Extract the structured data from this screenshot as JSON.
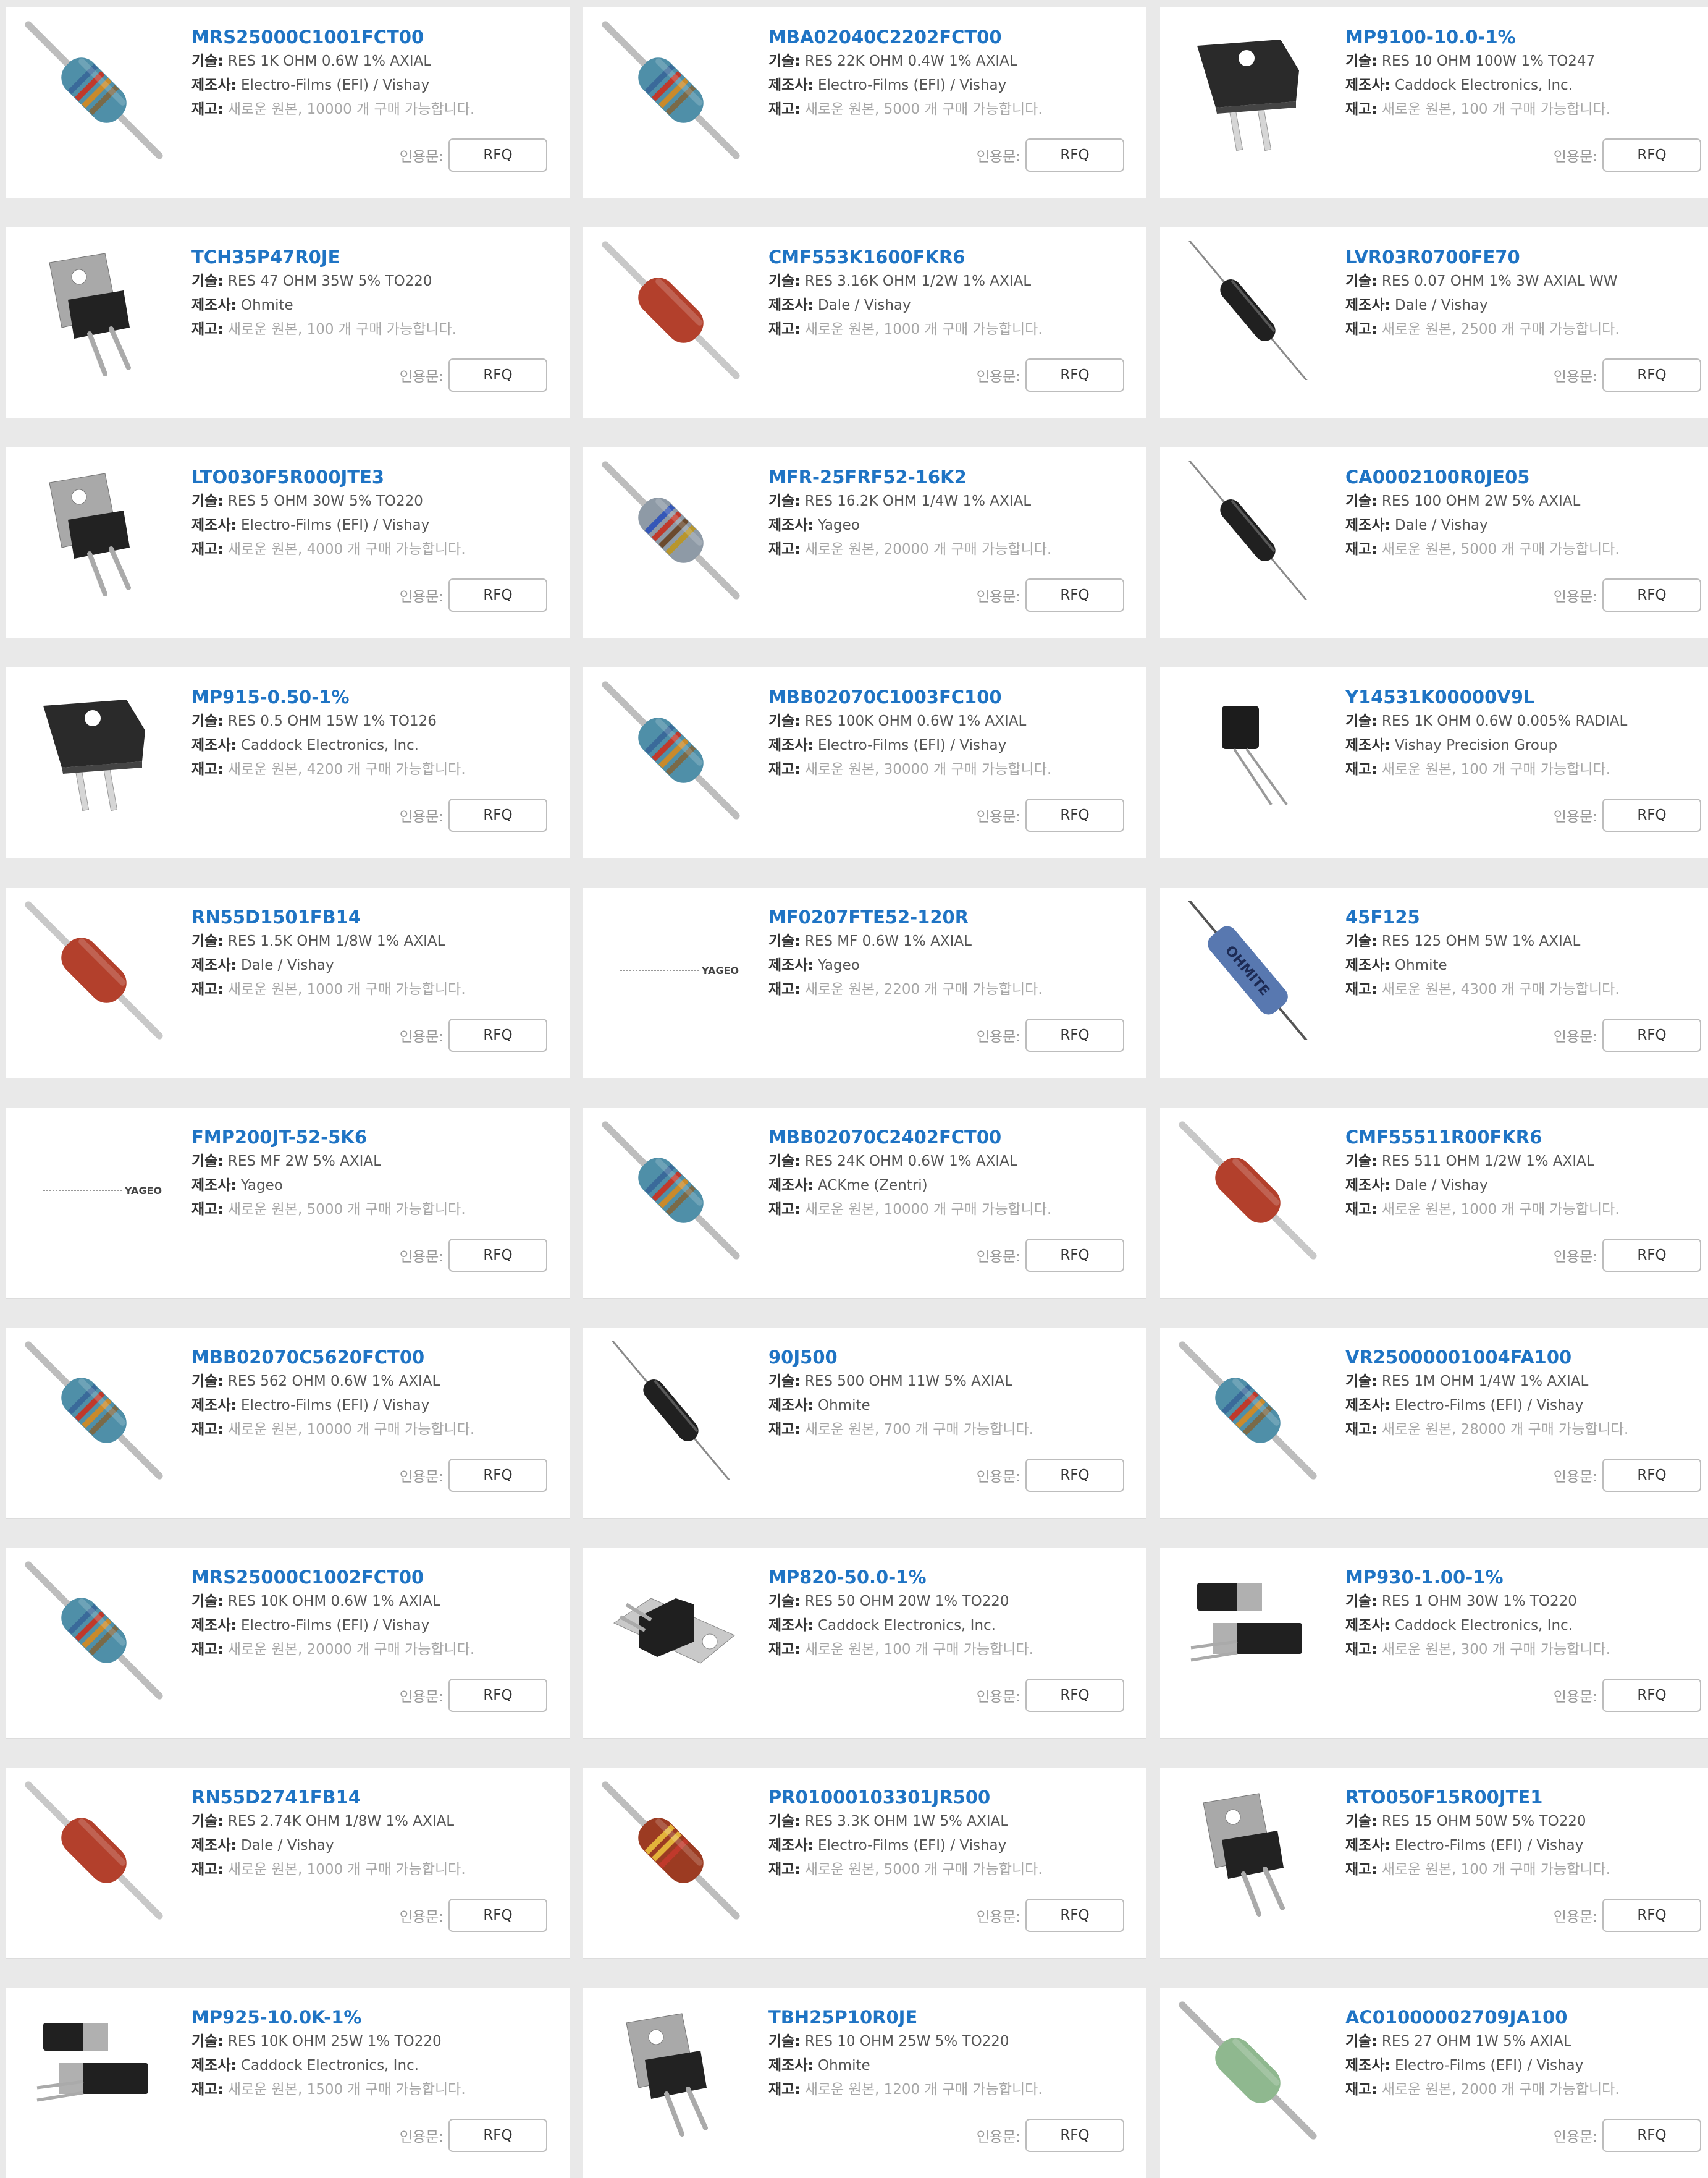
{
  "labels": {
    "desc": "기술:",
    "mfr": "제조사:",
    "stock": "재고:",
    "quote": "인용문:",
    "rfq": "RFQ"
  },
  "products": [
    {
      "part": "MRS25000C1001FCT00",
      "desc": "RES 1K OHM 0.6W 1% AXIAL",
      "mfr": "Electro-Films (EFI) / Vishay",
      "stock": "새로운 원본, 10000 개 구매 가능합니다.",
      "img": "axial-blue-resistor"
    },
    {
      "part": "MBA02040C2202FCT00",
      "desc": "RES 22K OHM 0.4W 1% AXIAL",
      "mfr": "Electro-Films (EFI) / Vishay",
      "stock": "새로운 원본, 5000 개 구매 가능합니다.",
      "img": "axial-blue-resistor"
    },
    {
      "part": "MP9100-10.0-1%",
      "desc": "RES 10 OHM 100W 1% TO247",
      "mfr": "Caddock Electronics, Inc.",
      "stock": "새로운 원본, 100 개 구매 가능합니다.",
      "img": "power-resistor-to247"
    },
    {
      "part": "TCH35P47R0JE",
      "desc": "RES 47 OHM 35W 5% TO220",
      "mfr": "Ohmite",
      "stock": "새로운 원본, 100 개 구매 가능합니다.",
      "img": "to220-tab-resistor"
    },
    {
      "part": "CMF553K1600FKR6",
      "desc": "RES 3.16K OHM 1/2W 1% AXIAL",
      "mfr": "Dale / Vishay",
      "stock": "새로운 원본, 1000 개 구매 가능합니다.",
      "img": "axial-red-resistor"
    },
    {
      "part": "LVR03R0700FE70",
      "desc": "RES 0.07 OHM 1% 3W AXIAL WW",
      "mfr": "Dale / Vishay",
      "stock": "새로운 원본, 2500 개 구매 가능합니다.",
      "img": "axial-black-resistor"
    },
    {
      "part": "LTO030F5R000JTE3",
      "desc": "RES 5 OHM 30W 5% TO220",
      "mfr": "Electro-Films (EFI) / Vishay",
      "stock": "새로운 원본, 4000 개 구매 가능합니다.",
      "img": "to220-tab-resistor"
    },
    {
      "part": "MFR-25FRF52-16K2",
      "desc": "RES 16.2K OHM 1/4W 1% AXIAL",
      "mfr": "Yageo",
      "stock": "새로운 원본, 20000 개 구매 가능합니다.",
      "img": "axial-gray-resistor"
    },
    {
      "part": "CA0002100R0JE05",
      "desc": "RES 100 OHM 2W 5% AXIAL",
      "mfr": "Dale / Vishay",
      "stock": "새로운 원본, 5000 개 구매 가능합니다.",
      "img": "axial-black-resistor"
    },
    {
      "part": "MP915-0.50-1%",
      "desc": "RES 0.5 OHM 15W 1% TO126",
      "mfr": "Caddock Electronics, Inc.",
      "stock": "새로운 원본, 4200 개 구매 가능합니다.",
      "img": "power-resistor-to247"
    },
    {
      "part": "MBB02070C1003FC100",
      "desc": "RES 100K OHM 0.6W 1% AXIAL",
      "mfr": "Electro-Films (EFI) / Vishay",
      "stock": "새로운 원본, 30000 개 구매 가능합니다.",
      "img": "axial-blue-resistor"
    },
    {
      "part": "Y14531K00000V9L",
      "desc": "RES 1K OHM 0.6W 0.005% RADIAL",
      "mfr": "Vishay Precision Group",
      "stock": "새로운 원본, 100 개 구매 가능합니다.",
      "img": "radial-resistor"
    },
    {
      "part": "RN55D1501FB14",
      "desc": "RES 1.5K OHM 1/8W 1% AXIAL",
      "mfr": "Dale / Vishay",
      "stock": "새로운 원본, 1000 개 구매 가능합니다.",
      "img": "axial-red-resistor"
    },
    {
      "part": "MF0207FTE52-120R",
      "desc": "RES MF 0.6W 1% AXIAL",
      "mfr": "Yageo",
      "stock": "새로운 원본, 2200 개 구매 가능합니다.",
      "img": "yageo-logo",
      "logo_text": "YAGEO"
    },
    {
      "part": "45F125",
      "desc": "RES 125 OHM 5W 1% AXIAL",
      "mfr": "Ohmite",
      "stock": "새로운 원본, 4300 개 구매 가능합니다.",
      "img": "ohmite-blue-resistor",
      "logo_text": "OHMITE"
    },
    {
      "part": "FMP200JT-52-5K6",
      "desc": "RES MF 2W 5% AXIAL",
      "mfr": "Yageo",
      "stock": "새로운 원본, 5000 개 구매 가능합니다.",
      "img": "yageo-logo",
      "logo_text": "YAGEO"
    },
    {
      "part": "MBB02070C2402FCT00",
      "desc": "RES 24K OHM 0.6W 1% AXIAL",
      "mfr": "ACKme (Zentri)",
      "stock": "새로운 원본, 10000 개 구매 가능합니다.",
      "img": "axial-blue-resistor"
    },
    {
      "part": "CMF55511R00FKR6",
      "desc": "RES 511 OHM 1/2W 1% AXIAL",
      "mfr": "Dale / Vishay",
      "stock": "새로운 원본, 1000 개 구매 가능합니다.",
      "img": "axial-red-resistor"
    },
    {
      "part": "MBB02070C5620FCT00",
      "desc": "RES 562 OHM 0.6W 1% AXIAL",
      "mfr": "Electro-Films (EFI) / Vishay",
      "stock": "새로운 원본, 10000 개 구매 가능합니다.",
      "img": "axial-blue-resistor"
    },
    {
      "part": "90J500",
      "desc": "RES 500 OHM 11W 5% AXIAL",
      "mfr": "Ohmite",
      "stock": "새로운 원본, 700 개 구매 가능합니다.",
      "img": "axial-black-resistor"
    },
    {
      "part": "VR25000001004FA100",
      "desc": "RES 1M OHM 1/4W 1% AXIAL",
      "mfr": "Electro-Films (EFI) / Vishay",
      "stock": "새로운 원본, 28000 개 구매 가능합니다.",
      "img": "axial-blue-resistor"
    },
    {
      "part": "MRS25000C1002FCT00",
      "desc": "RES 10K OHM 0.6W 1% AXIAL",
      "mfr": "Electro-Films (EFI) / Vishay",
      "stock": "새로운 원본, 20000 개 구매 가능합니다.",
      "img": "axial-blue-resistor"
    },
    {
      "part": "MP820-50.0-1%",
      "desc": "RES 50 OHM 20W 1% TO220",
      "mfr": "Caddock Electronics, Inc.",
      "stock": "새로운 원본, 100 개 구매 가능합니다.",
      "img": "to220-flat-resistor"
    },
    {
      "part": "MP930-1.00-1%",
      "desc": "RES 1 OHM 30W 1% TO220",
      "mfr": "Caddock Electronics, Inc.",
      "stock": "새로운 원본, 300 개 구매 가능합니다.",
      "img": "to220-pair-resistor"
    },
    {
      "part": "RN55D2741FB14",
      "desc": "RES 2.74K OHM 1/8W 1% AXIAL",
      "mfr": "Dale / Vishay",
      "stock": "새로운 원본, 1000 개 구매 가능합니다.",
      "img": "axial-red-resistor"
    },
    {
      "part": "PR01000103301JR500",
      "desc": "RES 3.3K OHM 1W 5% AXIAL",
      "mfr": "Electro-Films (EFI) / Vishay",
      "stock": "새로운 원본, 5000 개 구매 가능합니다.",
      "img": "axial-brown-resistor"
    },
    {
      "part": "RTO050F15R00JTE1",
      "desc": "RES 15 OHM 50W 5% TO220",
      "mfr": "Electro-Films (EFI) / Vishay",
      "stock": "새로운 원본, 100 개 구매 가능합니다.",
      "img": "to220-tab-resistor"
    },
    {
      "part": "MP925-10.0K-1%",
      "desc": "RES 10K OHM 25W 1% TO220",
      "mfr": "Caddock Electronics, Inc.",
      "stock": "새로운 원본, 1500 개 구매 가능합니다.",
      "img": "to220-pair-resistor"
    },
    {
      "part": "TBH25P10R0JE",
      "desc": "RES 10 OHM 25W 5% TO220",
      "mfr": "Ohmite",
      "stock": "새로운 원본, 1200 개 구매 가능합니다.",
      "img": "to220-tab-resistor"
    },
    {
      "part": "AC01000002709JA100",
      "desc": "RES 27 OHM 1W 5% AXIAL",
      "mfr": "Electro-Films (EFI) / Vishay",
      "stock": "새로운 원본, 2000 개 구매 가능합니다.",
      "img": "axial-green-resistor"
    }
  ]
}
